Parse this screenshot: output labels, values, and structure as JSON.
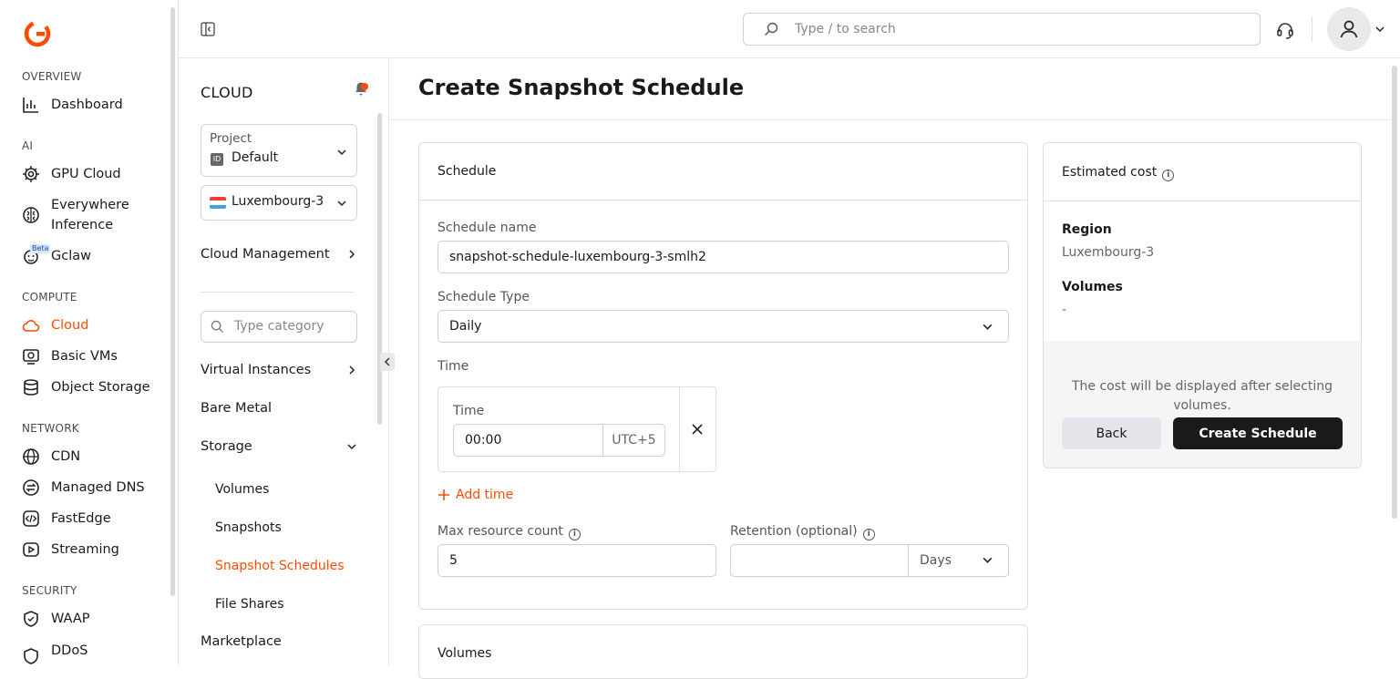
{
  "nav": {
    "sections": {
      "overview": "OVERVIEW",
      "ai": "AI",
      "compute": "COMPUTE",
      "network": "NETWORK",
      "security": "SECURITY"
    },
    "items": {
      "dashboard": "Dashboard",
      "gpu_cloud": "GPU Cloud",
      "everywhere_inference": "Everywhere Inference",
      "gclaw": "Gclaw",
      "gclaw_badge": "Beta",
      "cloud": "Cloud",
      "basic_vms": "Basic VMs",
      "object_storage": "Object Storage",
      "cdn": "CDN",
      "managed_dns": "Managed DNS",
      "fastedge": "FastEdge",
      "streaming": "Streaming",
      "waap": "WAAP",
      "ddos": "DDoS"
    },
    "accent_color": "#ff4b00"
  },
  "sub": {
    "title": "CLOUD",
    "project_label": "Project",
    "project_badge": "ID",
    "project_value": "Default",
    "region_value": "Luxembourg-3",
    "cloud_management": "Cloud Management",
    "category_placeholder": "Type category",
    "virtual_instances": "Virtual Instances",
    "bare_metal": "Bare Metal",
    "storage": "Storage",
    "storage_children": {
      "volumes": "Volumes",
      "snapshots": "Snapshots",
      "snapshot_schedules": "Snapshot Schedules",
      "file_shares": "File Shares"
    },
    "marketplace": "Marketplace"
  },
  "topbar": {
    "search_placeholder": "Type / to search"
  },
  "page": {
    "title": "Create Snapshot Schedule"
  },
  "schedule": {
    "heading": "Schedule",
    "name_label": "Schedule name",
    "name_value": "snapshot-schedule-luxembourg-3-smlh2",
    "type_label": "Schedule Type",
    "type_value": "Daily",
    "time_section_label": "Time",
    "time_label": "Time",
    "time_value": "00:00",
    "time_zone": "UTC+5",
    "add_time": "Add time",
    "max_resource_label": "Max resource count",
    "max_resource_value": "5",
    "retention_label": "Retention (optional)",
    "retention_value": "",
    "retention_unit": "Days"
  },
  "volumes": {
    "heading": "Volumes"
  },
  "cost": {
    "heading": "Estimated cost",
    "region_label": "Region",
    "region_value": "Luxembourg-3",
    "volumes_label": "Volumes",
    "volumes_value": "-",
    "note": "The cost will be displayed after selecting volumes.",
    "back_button": "Back",
    "create_button": "Create Schedule"
  }
}
